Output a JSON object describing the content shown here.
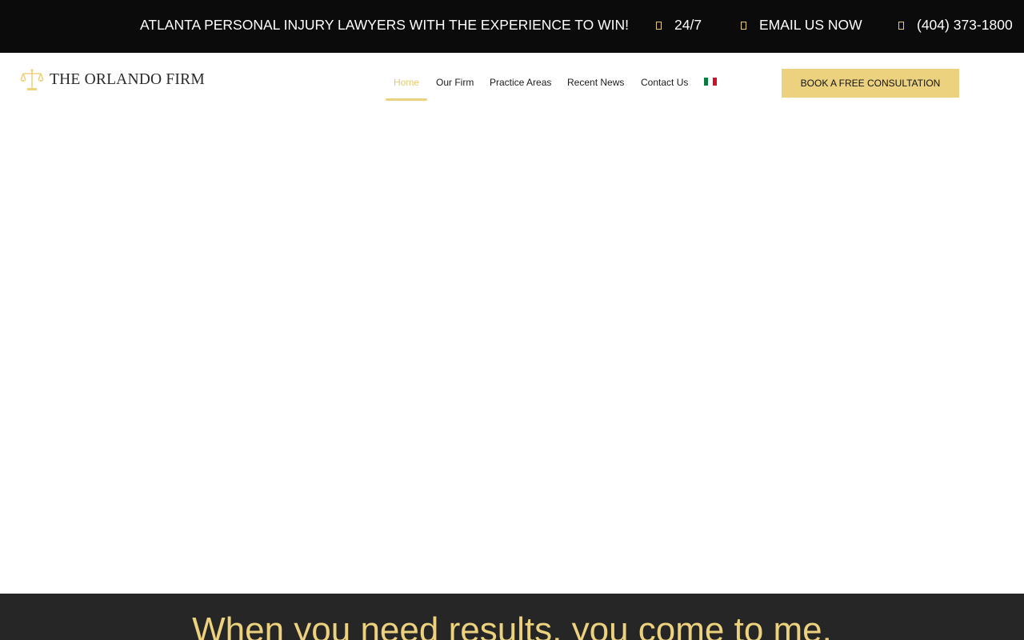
{
  "topbar": {
    "tagline": "ATLANTA PERSONAL INJURY LAWYERS WITH THE EXPERIENCE TO WIN!",
    "availability": "24/7",
    "email_link": "EMAIL US NOW",
    "phone": "(404) 373-1800",
    "icon_color": "#e5c96f"
  },
  "header": {
    "logo_text": "THE ORLANDO FIRM",
    "logo_icon": "scales-of-justice-icon",
    "nav": [
      {
        "label": "Home",
        "active": true
      },
      {
        "label": "Our Firm",
        "active": false
      },
      {
        "label": "Practice Areas",
        "active": false
      },
      {
        "label": "Recent News",
        "active": false
      },
      {
        "label": "Contact Us",
        "active": false
      }
    ],
    "language_flag": "mexico-flag-icon",
    "cta_label": "BOOK A FREE CONSULTATION"
  },
  "band": {
    "headline": "When you need results, you come to me."
  },
  "colors": {
    "accent": "#ecd27e",
    "topbar_bg": "#0b0b0b",
    "band_bg": "#262626"
  }
}
